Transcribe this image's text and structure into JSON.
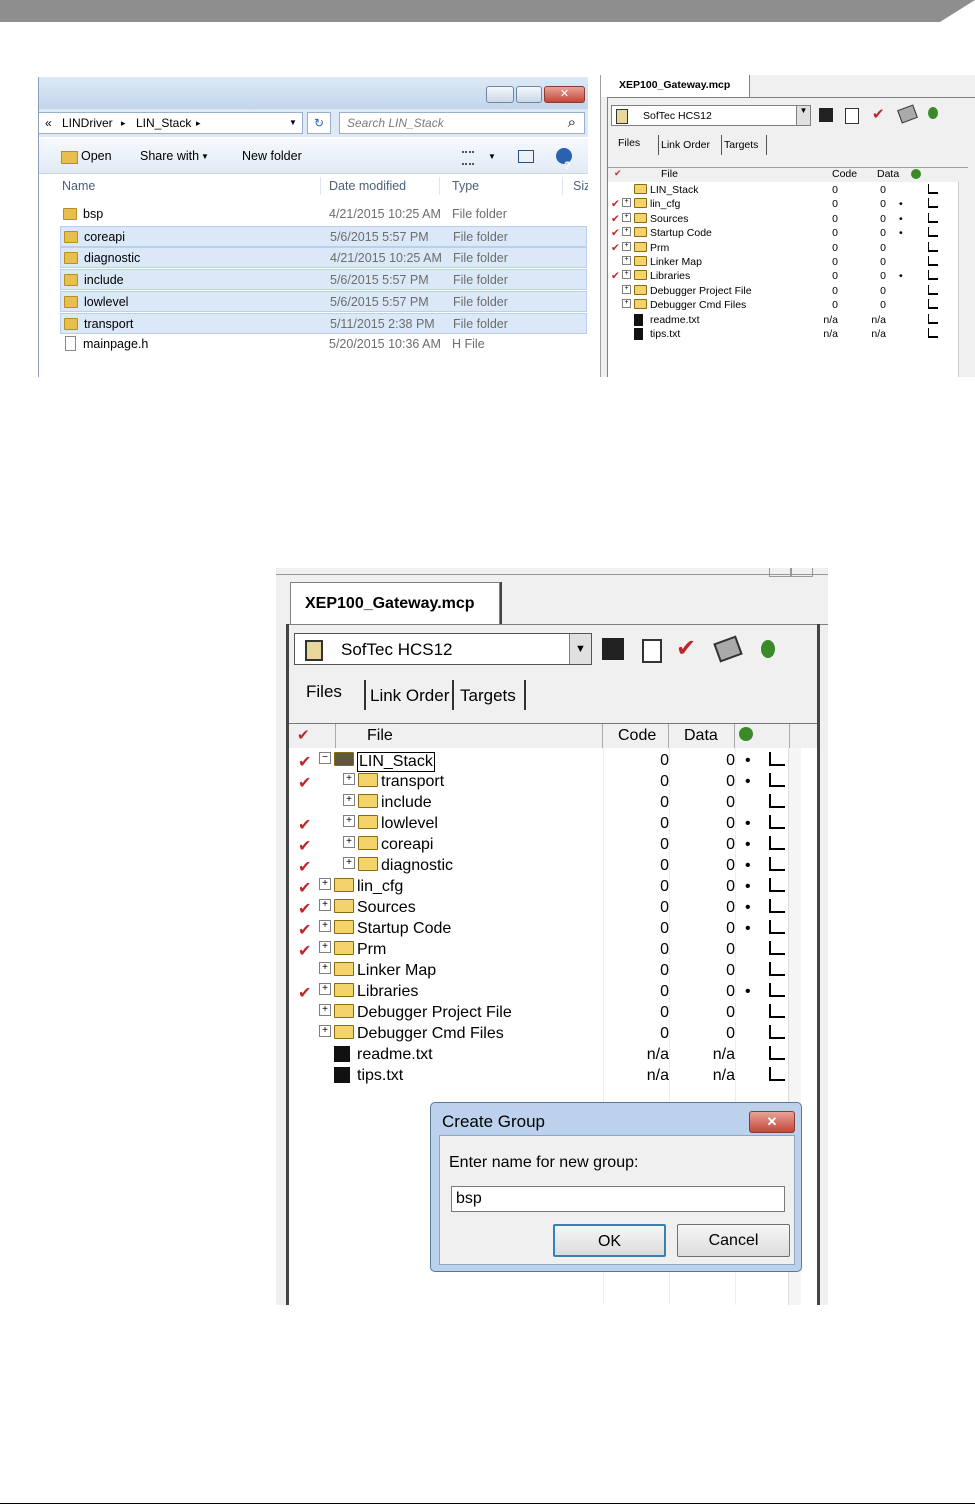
{
  "explorer": {
    "breadcrumb": [
      "«",
      "LINDriver",
      "LIN_Stack"
    ],
    "search_placeholder": "Search LIN_Stack",
    "toolbar": {
      "open": "Open",
      "share_with": "Share with",
      "new_folder": "New folder"
    },
    "columns": {
      "name": "Name",
      "date": "Date modified",
      "type": "Type",
      "size": "Siz"
    },
    "rows": [
      {
        "name": "bsp",
        "date": "4/21/2015 10:25 AM",
        "type": "File folder",
        "selected": false,
        "kind": "folder"
      },
      {
        "name": "coreapi",
        "date": "5/6/2015 5:57 PM",
        "type": "File folder",
        "selected": true,
        "kind": "folder"
      },
      {
        "name": "diagnostic",
        "date": "4/21/2015 10:25 AM",
        "type": "File folder",
        "selected": true,
        "kind": "folder"
      },
      {
        "name": "include",
        "date": "5/6/2015 5:57 PM",
        "type": "File folder",
        "selected": true,
        "kind": "folder"
      },
      {
        "name": "lowlevel",
        "date": "5/6/2015 5:57 PM",
        "type": "File folder",
        "selected": true,
        "kind": "folder"
      },
      {
        "name": "transport",
        "date": "5/11/2015 2:38 PM",
        "type": "File folder",
        "selected": true,
        "kind": "folder"
      },
      {
        "name": "mainpage.h",
        "date": "5/20/2015 10:36 AM",
        "type": "H File",
        "selected": false,
        "kind": "file"
      }
    ]
  },
  "ide_small": {
    "tab_title": "XEP100_Gateway.mcp",
    "target": "SofTec HCS12",
    "subtabs": {
      "files": "Files",
      "link_order": "Link Order",
      "targets": "Targets"
    },
    "columns": {
      "file": "File",
      "code": "Code",
      "data": "Data"
    },
    "rows": [
      {
        "check": false,
        "expand": false,
        "name": "LIN_Stack",
        "code": "0",
        "data": "0",
        "dot": false
      },
      {
        "check": true,
        "expand": true,
        "name": "lin_cfg",
        "code": "0",
        "data": "0",
        "dot": true
      },
      {
        "check": true,
        "expand": true,
        "name": "Sources",
        "code": "0",
        "data": "0",
        "dot": true
      },
      {
        "check": true,
        "expand": true,
        "name": "Startup Code",
        "code": "0",
        "data": "0",
        "dot": true
      },
      {
        "check": true,
        "expand": true,
        "name": "Prm",
        "code": "0",
        "data": "0",
        "dot": false
      },
      {
        "check": false,
        "expand": true,
        "name": "Linker Map",
        "code": "0",
        "data": "0",
        "dot": false
      },
      {
        "check": true,
        "expand": true,
        "name": "Libraries",
        "code": "0",
        "data": "0",
        "dot": true
      },
      {
        "check": false,
        "expand": true,
        "name": "Debugger Project File",
        "code": "0",
        "data": "0",
        "dot": false
      },
      {
        "check": false,
        "expand": true,
        "name": "Debugger Cmd Files",
        "code": "0",
        "data": "0",
        "dot": false
      },
      {
        "check": false,
        "expand": false,
        "name": "readme.txt",
        "code": "n/a",
        "data": "n/a",
        "dot": false,
        "kind": "txt"
      },
      {
        "check": false,
        "expand": false,
        "name": "tips.txt",
        "code": "n/a",
        "data": "n/a",
        "dot": false,
        "kind": "txt"
      }
    ]
  },
  "ide_large": {
    "tab_title": "XEP100_Gateway.mcp",
    "target": "SofTec HCS12",
    "subtabs": {
      "files": "Files",
      "link_order": "Link Order",
      "targets": "Targets"
    },
    "columns": {
      "file": "File",
      "code": "Code",
      "data": "Data"
    },
    "rows": [
      {
        "check": true,
        "level": 0,
        "sign": "−",
        "name": "LIN_Stack",
        "code": "0",
        "data": "0",
        "dot": true,
        "open": true
      },
      {
        "check": true,
        "level": 1,
        "sign": "+",
        "name": "transport",
        "code": "0",
        "data": "0",
        "dot": true
      },
      {
        "check": false,
        "level": 1,
        "sign": "+",
        "name": "include",
        "code": "0",
        "data": "0",
        "dot": false
      },
      {
        "check": true,
        "level": 1,
        "sign": "+",
        "name": "lowlevel",
        "code": "0",
        "data": "0",
        "dot": true
      },
      {
        "check": true,
        "level": 1,
        "sign": "+",
        "name": "coreapi",
        "code": "0",
        "data": "0",
        "dot": true
      },
      {
        "check": true,
        "level": 1,
        "sign": "+",
        "name": "diagnostic",
        "code": "0",
        "data": "0",
        "dot": true
      },
      {
        "check": true,
        "level": 0,
        "sign": "+",
        "name": "lin_cfg",
        "code": "0",
        "data": "0",
        "dot": true
      },
      {
        "check": true,
        "level": 0,
        "sign": "+",
        "name": "Sources",
        "code": "0",
        "data": "0",
        "dot": true
      },
      {
        "check": true,
        "level": 0,
        "sign": "+",
        "name": "Startup Code",
        "code": "0",
        "data": "0",
        "dot": true
      },
      {
        "check": true,
        "level": 0,
        "sign": "+",
        "name": "Prm",
        "code": "0",
        "data": "0",
        "dot": false
      },
      {
        "check": false,
        "level": 0,
        "sign": "+",
        "name": "Linker Map",
        "code": "0",
        "data": "0",
        "dot": false
      },
      {
        "check": true,
        "level": 0,
        "sign": "+",
        "name": "Libraries",
        "code": "0",
        "data": "0",
        "dot": true
      },
      {
        "check": false,
        "level": 0,
        "sign": "+",
        "name": "Debugger Project File",
        "code": "0",
        "data": "0",
        "dot": false
      },
      {
        "check": false,
        "level": 0,
        "sign": "+",
        "name": "Debugger Cmd Files",
        "code": "0",
        "data": "0",
        "dot": false
      },
      {
        "check": false,
        "level": 0,
        "sign": "",
        "name": "readme.txt",
        "code": "n/a",
        "data": "n/a",
        "dot": false,
        "kind": "txt"
      },
      {
        "check": false,
        "level": 0,
        "sign": "",
        "name": "tips.txt",
        "code": "n/a",
        "data": "n/a",
        "dot": false,
        "kind": "txt"
      }
    ]
  },
  "dialog": {
    "title": "Create Group",
    "prompt": "Enter name for new group:",
    "value": "bsp",
    "ok": "OK",
    "cancel": "Cancel",
    "close_symbol": "✕"
  },
  "glyphs": {
    "check": "✔",
    "dot": "•",
    "chevron": "▸",
    "dropdown": "▼",
    "refresh": "↻",
    "search": "⌕",
    "help": "?"
  },
  "colors": {
    "check": "#c0272d",
    "selection": "#dbe8f8",
    "folder": "#e7bf4d",
    "close_button": "#c9463d"
  }
}
